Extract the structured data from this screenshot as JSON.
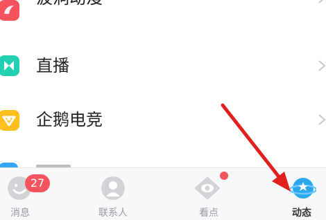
{
  "menu": {
    "items": [
      {
        "label": "波洞动漫",
        "icon": "bodong-comic-icon",
        "icon_color": "#f5545f"
      },
      {
        "label": "直播",
        "icon": "live-stream-icon",
        "icon_color": "#22cfb0"
      },
      {
        "label": "企鹅电竞",
        "icon": "penguin-esports-icon",
        "icon_color": "#ffbf1f"
      }
    ],
    "partial_item": {
      "icon": "partial-app-icon",
      "icon_color": "#31a8f5"
    }
  },
  "tabbar": {
    "tabs": [
      {
        "label": "消息",
        "icon": "messages-icon",
        "badge": "27"
      },
      {
        "label": "联系人",
        "icon": "contacts-icon"
      },
      {
        "label": "看点",
        "icon": "eye-icon",
        "has_dot": true
      },
      {
        "label": "动态",
        "icon": "planet-icon",
        "active": true
      }
    ]
  },
  "colors": {
    "accent_red": "#f5545f",
    "arrow": "#e02020",
    "active_planet": "#2aa7ee"
  }
}
